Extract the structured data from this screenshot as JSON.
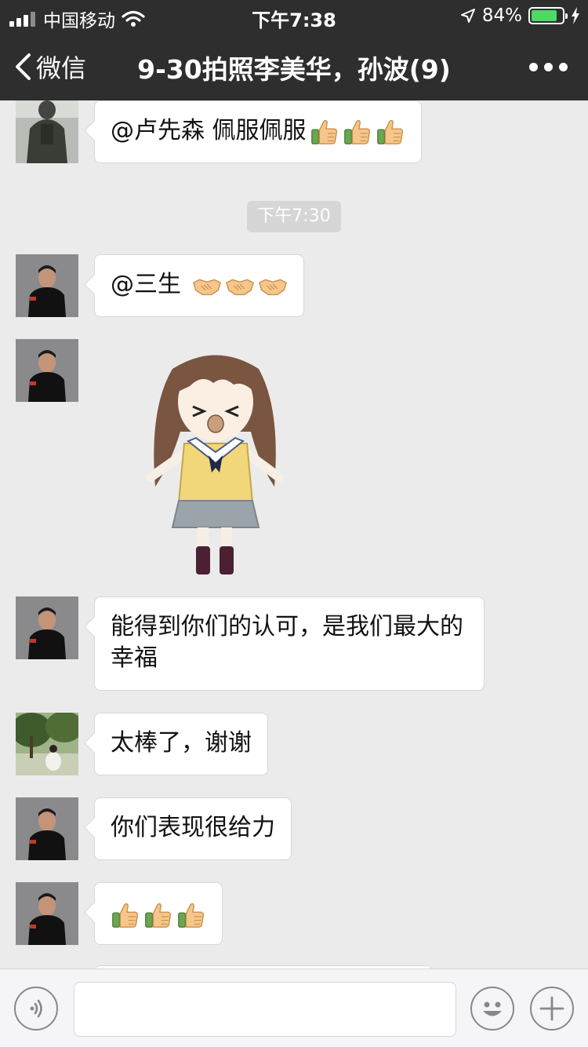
{
  "status_bar": {
    "carrier": "中国移动",
    "time": "下午7:38",
    "battery_percent": "84%",
    "battery_level": 0.84,
    "icons": [
      "signal-icon",
      "wifi-icon",
      "location-icon",
      "battery-icon",
      "charging-icon"
    ]
  },
  "nav": {
    "back_label": "微信",
    "title": "9-30拍照李美华，孙波(9)",
    "more_icon": "more-icon"
  },
  "chat": {
    "timestamp": "下午7:30",
    "messages": [
      {
        "text": "@卢先森 佩服佩服",
        "emoji": [
          "thumbs-up",
          "thumbs-up",
          "thumbs-up"
        ],
        "avatar": "soldier-avatar"
      },
      {
        "text": "@三生 ",
        "emoji": [
          "handshake",
          "handshake",
          "handshake"
        ],
        "avatar": "man-avatar"
      },
      {
        "sticker": "anime-girl-sticker",
        "avatar": "man-avatar"
      },
      {
        "text": "能得到你们的认可，是我们最大的幸福",
        "avatar": "man-avatar"
      },
      {
        "text": "太棒了，谢谢",
        "avatar": "outdoor-photo-avatar"
      },
      {
        "text": "你们表现很给力",
        "avatar": "man-avatar"
      },
      {
        "text": "",
        "emoji": [
          "thumbs-up",
          "thumbs-up",
          "thumbs-up"
        ],
        "avatar": "man-avatar"
      }
    ]
  },
  "input_bar": {
    "voice_icon": "voice-icon",
    "input_value": "",
    "emoji_icon": "smiley-icon",
    "plus_icon": "plus-icon"
  },
  "colors": {
    "header_bg": "#2e2e2f",
    "chat_bg": "#ebebeb",
    "bubble_bg": "#ffffff",
    "battery_green": "#4cd964"
  }
}
